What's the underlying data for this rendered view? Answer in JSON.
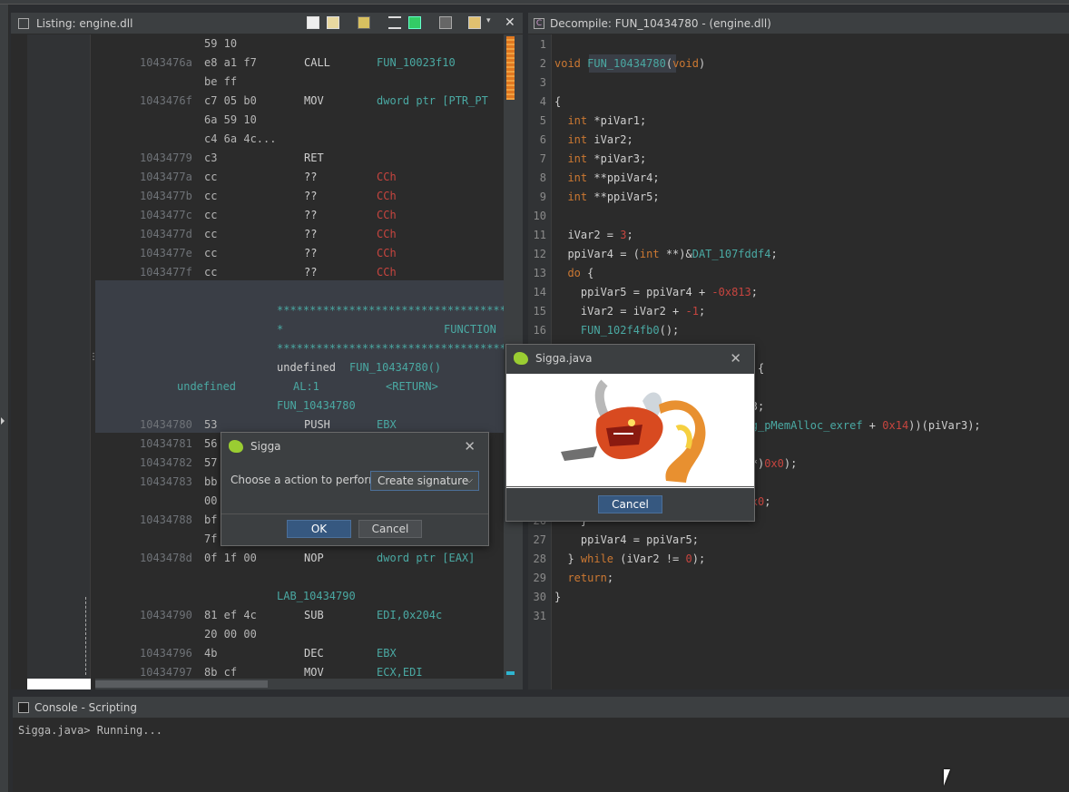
{
  "listing": {
    "title": "Listing:  engine.dll",
    "rows": [
      {
        "addr": "",
        "hex": "59 10",
        "mn": "",
        "op": ""
      },
      {
        "addr": "1043476a",
        "hex": "e8 a1 f7",
        "mn": "CALL",
        "op": "FUN_10023f10"
      },
      {
        "addr": "",
        "hex": "be ff",
        "mn": "",
        "op": ""
      },
      {
        "addr": "1043476f",
        "hex": "c7 05 b0",
        "mn": "MOV",
        "op": "dword ptr [PTR_PT"
      },
      {
        "addr": "",
        "hex": "6a 59 10",
        "mn": "",
        "op": ""
      },
      {
        "addr": "",
        "hex": "c4 6a 4c...",
        "mn": "",
        "op": ""
      },
      {
        "addr": "10434779",
        "hex": "c3",
        "mn": "RET",
        "op": ""
      },
      {
        "addr": "1043477a",
        "hex": "cc",
        "mn": "??",
        "op": "CCh"
      },
      {
        "addr": "1043477b",
        "hex": "cc",
        "mn": "??",
        "op": "CCh"
      },
      {
        "addr": "1043477c",
        "hex": "cc",
        "mn": "??",
        "op": "CCh"
      },
      {
        "addr": "1043477d",
        "hex": "cc",
        "mn": "??",
        "op": "CCh"
      },
      {
        "addr": "1043477e",
        "hex": "cc",
        "mn": "??",
        "op": "CCh"
      },
      {
        "addr": "1043477f",
        "hex": "cc",
        "mn": "??",
        "op": "CCh"
      }
    ],
    "stars1": "*************************************",
    "function_star": "*",
    "function_label": "FUNCTION",
    "stars2": "*************************************",
    "signature_type": "undefined",
    "signature_name": "FUN_10434780()",
    "param_type": "undefined",
    "param_reg": "AL:1",
    "param_name": "<RETURN>",
    "func_label": "FUN_10434780",
    "rows2": [
      {
        "addr": "10434780",
        "hex": "53",
        "mn": "PUSH",
        "op": "EBX"
      },
      {
        "addr": "10434781",
        "hex": "56",
        "mn": "",
        "op": ""
      },
      {
        "addr": "10434782",
        "hex": "57",
        "mn": "",
        "op": ""
      },
      {
        "addr": "10434783",
        "hex": "bb",
        "mn": "",
        "op": ""
      },
      {
        "addr": "",
        "hex": "00",
        "mn": "",
        "op": ""
      },
      {
        "addr": "10434788",
        "hex": "bf",
        "mn": "",
        "op": ""
      },
      {
        "addr": "",
        "hex": "7f",
        "mn": "",
        "op": ""
      },
      {
        "addr": "1043478d",
        "hex": "0f 1f 00",
        "mn": "NOP",
        "op": "dword ptr [EAX]"
      }
    ],
    "lab_label": "LAB_10434790",
    "rows3": [
      {
        "addr": "10434790",
        "hex": "81 ef 4c",
        "mn": "SUB",
        "op": "EDI,0x204c"
      },
      {
        "addr": "",
        "hex": "20 00 00",
        "mn": "",
        "op": ""
      },
      {
        "addr": "10434796",
        "hex": "4b",
        "mn": "DEC",
        "op": "EBX"
      },
      {
        "addr": "10434797",
        "hex": "8b cf",
        "mn": "MOV",
        "op": "ECX,EDI"
      }
    ]
  },
  "decompile": {
    "title": "Decompile: FUN_10434780 -  (engine.dll)",
    "lines": [
      {
        "n": "1",
        "t": ""
      },
      {
        "n": "2",
        "t": "void FUN_10434780(void)"
      },
      {
        "n": "3",
        "t": ""
      },
      {
        "n": "4",
        "t": "{"
      },
      {
        "n": "5",
        "t": "  int *piVar1;"
      },
      {
        "n": "6",
        "t": "  int iVar2;"
      },
      {
        "n": "7",
        "t": "  int *piVar3;"
      },
      {
        "n": "8",
        "t": "  int **ppiVar4;"
      },
      {
        "n": "9",
        "t": "  int **ppiVar5;"
      },
      {
        "n": "10",
        "t": ""
      },
      {
        "n": "11",
        "t": "  iVar2 = 3;"
      },
      {
        "n": "12",
        "t": "  ppiVar4 = (int **)&DAT_107fddf4;"
      },
      {
        "n": "13",
        "t": "  do {"
      },
      {
        "n": "14",
        "t": "    ppiVar5 = ppiVar4 + -0x813;"
      },
      {
        "n": "15",
        "t": "    iVar2 = iVar2 + -1;"
      },
      {
        "n": "16",
        "t": "    FUN_102f4fb0();"
      },
      {
        "n": "17",
        "t": ""
      },
      {
        "n": "18",
        "t": "                           x0) {"
      },
      {
        "n": "19",
        "t": ""
      },
      {
        "n": "20",
        "t": "                           Var3;"
      },
      {
        "n": "21",
        "t": "                           **)g_pMemAlloc_exref + 0x14))(piVar3);"
      },
      {
        "n": "22",
        "t": ""
      },
      {
        "n": "23",
        "t": "                           nt *)0x0);"
      },
      {
        "n": "24",
        "t": ""
      },
      {
        "n": "25",
        "t": "                           *)0x0;"
      },
      {
        "n": "26",
        "t": "    }"
      },
      {
        "n": "27",
        "t": "    ppiVar4 = ppiVar5;"
      },
      {
        "n": "28",
        "t": "  } while (iVar2 != 0);"
      },
      {
        "n": "29",
        "t": "  return;"
      },
      {
        "n": "30",
        "t": "}"
      },
      {
        "n": "31",
        "t": ""
      }
    ]
  },
  "console": {
    "title": "Console - Scripting",
    "output": "Sigga.java> Running..."
  },
  "sigga_dialog": {
    "title": "Sigga",
    "prompt": "Choose a action to perform",
    "selected": "Create signature",
    "ok": "OK",
    "cancel": "Cancel"
  },
  "sigga_java_dialog": {
    "title": "Sigga.java",
    "cancel": "Cancel"
  },
  "colors": {
    "accent": "#365880",
    "teal": "#4aa9a3",
    "red": "#c7453f"
  }
}
